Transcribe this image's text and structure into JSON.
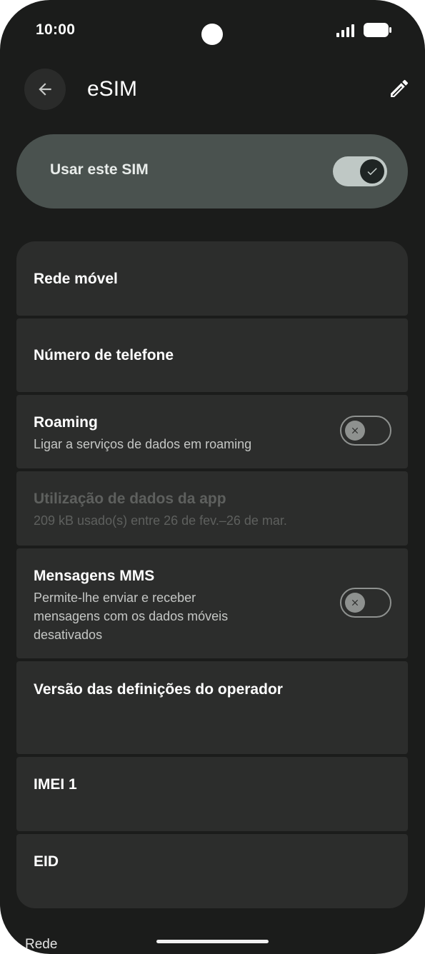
{
  "status": {
    "time": "10:00"
  },
  "header": {
    "title": "eSIM"
  },
  "use_sim": {
    "label": "Usar este SIM",
    "enabled": true
  },
  "items": [
    {
      "title": "Rede móvel"
    },
    {
      "title": "Número de telefone"
    },
    {
      "title": "Roaming",
      "subtitle": "Ligar a serviços de dados em roaming",
      "toggle": false
    },
    {
      "title": "Utilização de dados da app",
      "subtitle": "209 kB usado(s) entre 26 de fev.–26 de mar.",
      "disabled": true
    },
    {
      "title": "Mensagens MMS",
      "subtitle_lines": [
        "Permite-lhe enviar e receber",
        "mensagens com os dados móveis",
        "desativados"
      ],
      "toggle": false
    },
    {
      "title": "Versão das definições do operador"
    },
    {
      "title": "IMEI 1"
    },
    {
      "title": "EID"
    }
  ],
  "footer": {
    "section_label": "Rede"
  },
  "colors": {
    "background": "#1b1c1b",
    "card": "#2c2d2c",
    "use_card": "#4a524f",
    "toggle_on_track": "#bfc8c5"
  }
}
